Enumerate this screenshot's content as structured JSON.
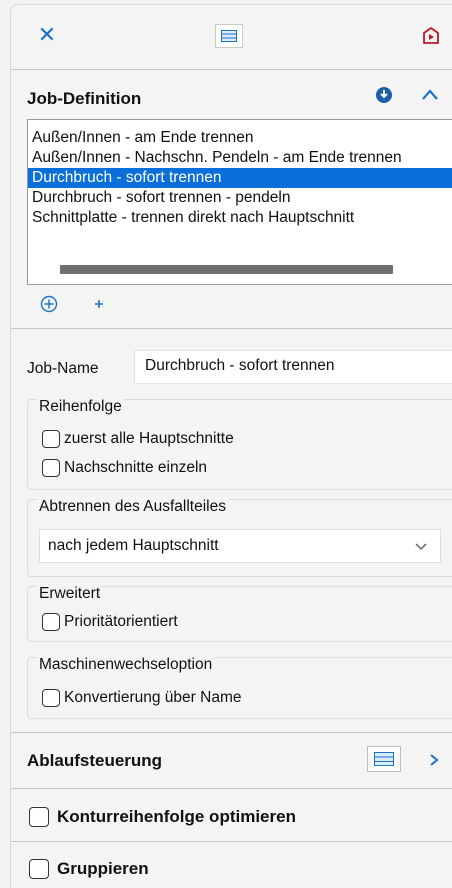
{
  "toolbar": {
    "close_icon": "close-icon",
    "table_icon": "table-icon",
    "navigate_icon": "navigate-icon"
  },
  "job_definition": {
    "title": "Job-Definition",
    "list": [
      {
        "label": "Außen/Innen - am Ende trennen",
        "selected": false
      },
      {
        "label": "Außen/Innen - Nachschn. Pendeln - am Ende trennen",
        "selected": false
      },
      {
        "label": "Durchbruch - sofort trennen",
        "selected": true
      },
      {
        "label": "Durchbruch - sofort trennen - pendeln",
        "selected": false
      },
      {
        "label": "Schnittplatte - trennen direkt nach Hauptschnitt",
        "selected": false
      }
    ],
    "add_icon": "add-circle-icon",
    "plus_icon": "plus-icon"
  },
  "job_name": {
    "label": "Job-Name",
    "value": "Durchbruch - sofort trennen"
  },
  "reihenfolge": {
    "title": "Reihenfolge",
    "options": [
      {
        "label": "zuerst alle Hauptschnitte",
        "checked": false
      },
      {
        "label": "Nachschnitte einzeln",
        "checked": false
      }
    ]
  },
  "abtrennen": {
    "title": "Abtrennen des Ausfallteiles",
    "selected": "nach jedem Hauptschnitt"
  },
  "erweitert": {
    "title": "Erweitert",
    "option": {
      "label": "Prioritätorientiert",
      "checked": false
    }
  },
  "maschinenwechsel": {
    "title": "Maschinenwechseloption",
    "option": {
      "label": "Konvertierung über Name",
      "checked": false
    }
  },
  "ablaufsteuerung": {
    "title": "Ablaufsteuerung"
  },
  "kontur": {
    "label": "Konturreihenfolge optimieren",
    "checked": false
  },
  "gruppieren": {
    "label": "Gruppieren",
    "checked": false
  },
  "colors": {
    "accent": "#1a73c8",
    "selection": "#0a6fd8",
    "nav_red": "#c0182a"
  }
}
